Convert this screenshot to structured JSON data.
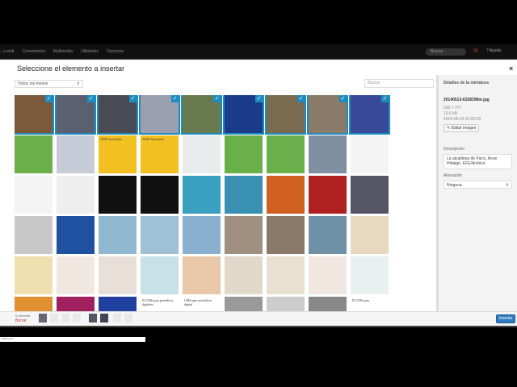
{
  "adminbar": {
    "items": [
      "...o web",
      "Comentarios",
      "Multimedia",
      "Utilidades",
      "Opciones"
    ],
    "search": "Buscar",
    "help": "Ayuda"
  },
  "modal": {
    "title": "Seleccione el elemento a insertar",
    "close": "×",
    "filter": "Todos los meses",
    "search_placeholder": "Buscar"
  },
  "details": {
    "heading": "Detalles de la miniatura",
    "filename": "20140513-6258398m.jpg",
    "dimensions": "550 × 377",
    "size": "19.6 kB",
    "date": "2014-05-13 21:00:29",
    "edit_label": "Editar imagen",
    "description_label": "Descripción",
    "description": "La alcaldesa de París, Anne Hidalgo. EFE/Archivo",
    "align_label": "Alineación",
    "align_value": "Ninguna"
  },
  "tiles": [
    {
      "c": "#7a5a3a",
      "s": 1
    },
    {
      "c": "#5a6070",
      "s": 1
    },
    {
      "c": "#4a4a55",
      "s": 1
    },
    {
      "c": "#9aa0b0",
      "s": 1
    },
    {
      "c": "#6a7a50",
      "s": 1
    },
    {
      "c": "#1a3a8a",
      "s": 1
    },
    {
      "c": "#7a6a50",
      "s": 1
    },
    {
      "c": "#8a7a6a",
      "s": 1
    },
    {
      "c": "#3a4a9a",
      "s": 1
    },
    {
      "c": "#6ab04a",
      "t": ""
    },
    {
      "c": "#c8ccd8",
      "t": ""
    },
    {
      "c": "#f2c020",
      "t": "ADIS Suscríbete"
    },
    {
      "c": "#f2c020",
      "t": "ADIS Suscríbete"
    },
    {
      "c": "#e8ecec",
      "t": ""
    },
    {
      "c": "#6ab04a",
      "t": ""
    },
    {
      "c": "#6ab04a",
      "t": ""
    },
    {
      "c": "#8090a0",
      "t": ""
    },
    {
      "c": "#f4f4f4",
      "t": ""
    },
    {
      "c": "#f4f4f4"
    },
    {
      "c": "#eeeeee"
    },
    {
      "c": "#111"
    },
    {
      "c": "#111"
    },
    {
      "c": "#3aa0c0"
    },
    {
      "c": "#3a90b0"
    },
    {
      "c": "#d06020"
    },
    {
      "c": "#b02020"
    },
    {
      "c": "#556"
    },
    {
      "c": "#c8c8c8"
    },
    {
      "c": "#2050a0"
    },
    {
      "c": "#90b8d0"
    },
    {
      "c": "#a0c0d8"
    },
    {
      "c": "#8ab0d0"
    },
    {
      "c": "#a09080"
    },
    {
      "c": "#8a7a6a"
    },
    {
      "c": "#7090a8"
    },
    {
      "c": "#e8d8c0"
    },
    {
      "c": "#f0e0b0"
    },
    {
      "c": "#f0e8e0"
    },
    {
      "c": "#e8e0d8"
    },
    {
      "c": "#c8e0e8"
    },
    {
      "c": "#e8c8a8"
    },
    {
      "c": "#e0d8c8"
    },
    {
      "c": "#e8e0d0"
    },
    {
      "c": "#f0e8e0"
    },
    {
      "c": "#e8f0f0"
    },
    {
      "c": "#e09030"
    },
    {
      "c": "#a02060"
    },
    {
      "c": "#2040a0"
    },
    {
      "c": "#fff",
      "t": "El CMS para periódicos digitales"
    },
    {
      "c": "#fff",
      "t": "CMS para periódicos digital"
    },
    {
      "c": "#999"
    },
    {
      "c": "#ccc"
    },
    {
      "c": "#888"
    },
    {
      "c": "#fff",
      "t": "El CMS para"
    }
  ],
  "footer": {
    "selected": "9 selected",
    "clear": "Borrar",
    "insert": "Insertar"
  },
  "statusbar": "Waiting for ..."
}
